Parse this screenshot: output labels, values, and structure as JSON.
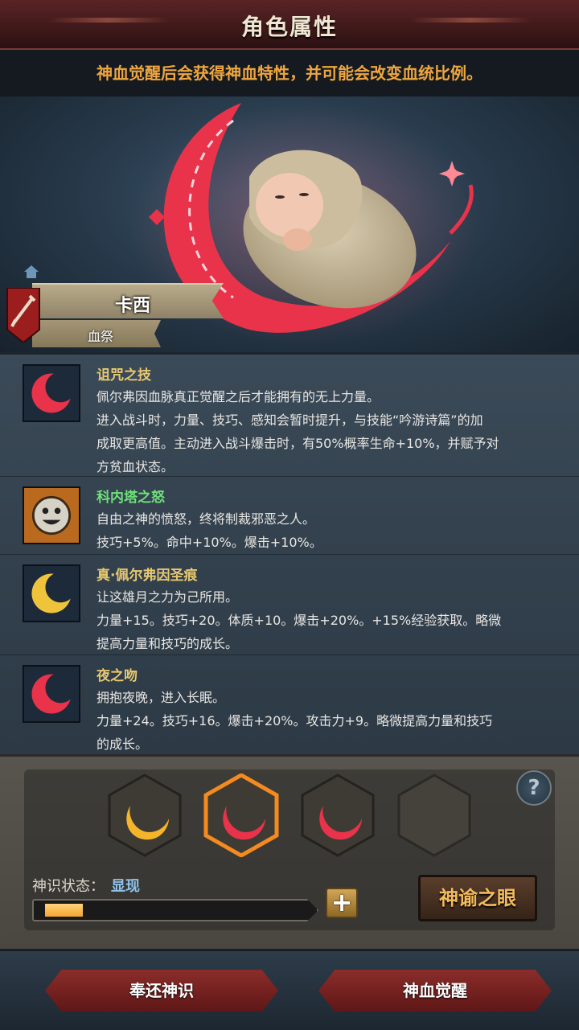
{
  "header": {
    "title": "角色属性"
  },
  "notice": "神血觉醒后会获得神血特性，并可能会改变血统比例。",
  "character": {
    "name": "卡西",
    "subtitle": "血祭"
  },
  "traits": [
    {
      "name": "诅咒之技",
      "name_color": "#e7c86f",
      "icon": "red-crescent-icon",
      "lines": [
        "佩尔弗因血脉真正觉醒之后才能拥有的无上力量。",
        "进入战斗时，力量、技巧、感知会暂时提升，与技能“吟游诗篇”的加",
        "成取更高值。主动进入战斗爆击时，有50%概率生命+10%，并赋予对",
        "方贫血状态。"
      ]
    },
    {
      "name": "科内塔之怒",
      "name_color": "#6fe07a",
      "icon": "sun-face-icon",
      "lines": [
        "自由之神的愤怒，终将制裁邪恶之人。",
        "技巧+5%。命中+10%。爆击+10%。"
      ]
    },
    {
      "name": "真·佩尔弗因圣痕",
      "name_color": "#e7c86f",
      "icon": "gold-crescent-icon",
      "lines": [
        "让这雄月之力为己所用。",
        "力量+15。技巧+20。体质+10。爆击+20%。+15%经验获取。略微",
        "提高力量和技巧的成长。"
      ]
    },
    {
      "name": "夜之吻",
      "name_color": "#e7c86f",
      "icon": "red-crescent-icon",
      "lines": [
        "拥抱夜晚，进入长眠。",
        "力量+24。技巧+16。爆击+20%。攻击力+9。略微提高力量和技巧",
        "的成长。"
      ]
    }
  ],
  "slots": [
    {
      "icon": "gold-crescent-icon",
      "selected": false
    },
    {
      "icon": "red-crescent-icon",
      "selected": true
    },
    {
      "icon": "red-crescent-icon",
      "selected": false
    },
    {
      "icon": "empty-slot",
      "selected": false
    }
  ],
  "divine_status": {
    "label": "神识状态：",
    "value": "显现",
    "progress": 0.15
  },
  "buttons": {
    "plus": "+",
    "oracle": "神谕之眼",
    "return": "奉还神识",
    "awaken": "神血觉醒",
    "help": "?"
  },
  "colors": {
    "accent_red": "#e8334a",
    "gold": "#f3bb5c",
    "header_red": "#5a2325"
  }
}
